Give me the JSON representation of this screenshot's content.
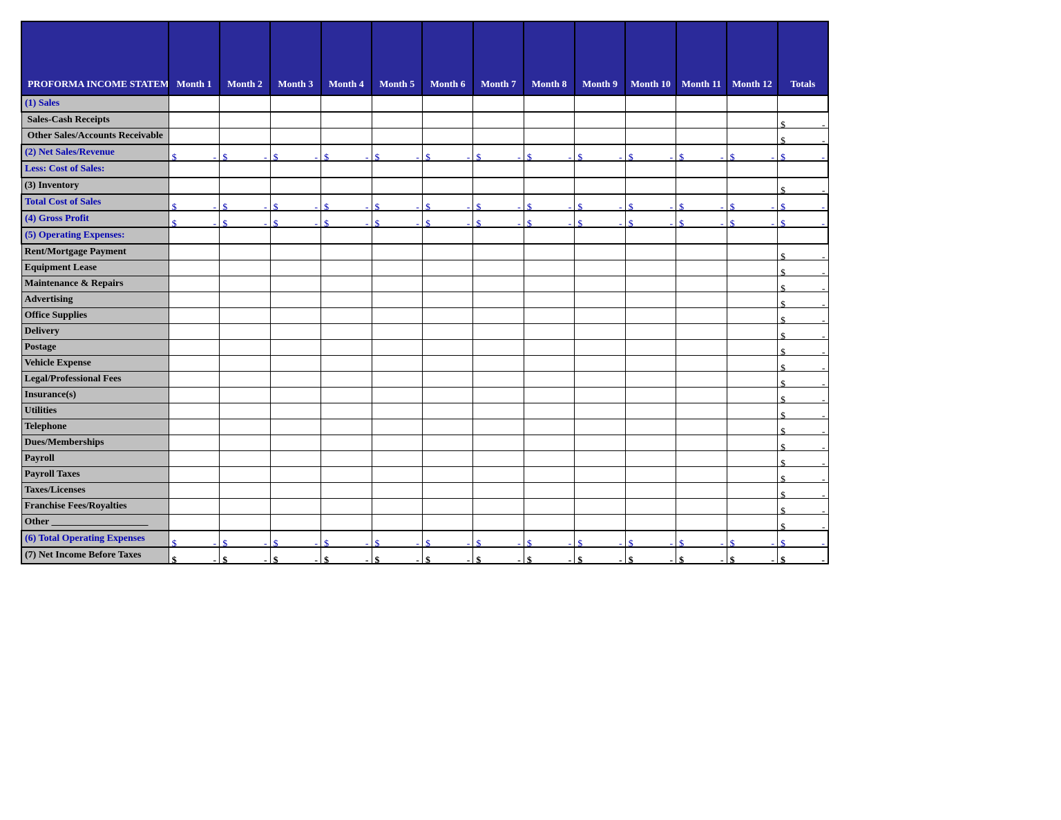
{
  "title": "PROFORMA INCOME STATEMENT",
  "months": [
    "Month 1",
    "Month 2",
    "Month 3",
    "Month 4",
    "Month 5",
    "Month 6",
    "Month 7",
    "Month 8",
    "Month 9",
    "Month 10",
    "Month 11",
    "Month 12"
  ],
  "totals_label": "Totals",
  "currency_symbol": "$",
  "dash": "-",
  "rows": [
    {
      "label": "(1) Sales",
      "style": "section",
      "blue": true,
      "months": "none",
      "total": "none"
    },
    {
      "label": "Sales-Cash Receipts",
      "style": "indent",
      "blue": false,
      "months": "none",
      "total": "dash"
    },
    {
      "label": "Other Sales/Accounts Receivable",
      "style": "indent",
      "blue": false,
      "months": "none",
      "total": "dash"
    },
    {
      "label": "(2) Net Sales/Revenue",
      "style": "subtotal",
      "blue": true,
      "months": "blue",
      "total": "blue"
    },
    {
      "label": "Less: Cost of Sales:",
      "style": "section",
      "blue": true,
      "months": "none",
      "total": "none"
    },
    {
      "label": "(3) Inventory",
      "style": "plain",
      "blue": false,
      "months": "none",
      "total": "dash"
    },
    {
      "label": "Total Cost of Sales",
      "style": "subtotal",
      "blue": true,
      "months": "blue",
      "total": "blue"
    },
    {
      "label": "(4) Gross Profit",
      "style": "subtotal",
      "blue": true,
      "months": "blue",
      "total": "blue"
    },
    {
      "label": "(5) Operating Expenses:",
      "style": "section",
      "blue": true,
      "months": "none",
      "total": "none"
    },
    {
      "label": "Rent/Mortgage Payment",
      "style": "plain",
      "blue": false,
      "months": "none",
      "total": "dash"
    },
    {
      "label": "Equipment Lease",
      "style": "plain",
      "blue": false,
      "months": "none",
      "total": "dash"
    },
    {
      "label": "Maintenance & Repairs",
      "style": "plain",
      "blue": false,
      "months": "none",
      "total": "dash"
    },
    {
      "label": "Advertising",
      "style": "plain",
      "blue": false,
      "months": "none",
      "total": "dash"
    },
    {
      "label": "Office Supplies",
      "style": "plain",
      "blue": false,
      "months": "none",
      "total": "dash"
    },
    {
      "label": "Delivery",
      "style": "plain",
      "blue": false,
      "months": "none",
      "total": "dash"
    },
    {
      "label": "Postage",
      "style": "plain",
      "blue": false,
      "months": "none",
      "total": "dash"
    },
    {
      "label": "Vehicle Expense",
      "style": "plain",
      "blue": false,
      "months": "none",
      "total": "dash"
    },
    {
      "label": "Legal/Professional Fees",
      "style": "plain",
      "blue": false,
      "months": "none",
      "total": "dash"
    },
    {
      "label": "Insurance(s)",
      "style": "plain",
      "blue": false,
      "months": "none",
      "total": "dash"
    },
    {
      "label": "Utilities",
      "style": "plain",
      "blue": false,
      "months": "none",
      "total": "dash"
    },
    {
      "label": "Telephone",
      "style": "plain",
      "blue": false,
      "months": "none",
      "total": "dash"
    },
    {
      "label": "Dues/Memberships",
      "style": "plain",
      "blue": false,
      "months": "none",
      "total": "dash"
    },
    {
      "label": "Payroll",
      "style": "plain",
      "blue": false,
      "months": "none",
      "total": "dash"
    },
    {
      "label": "Payroll Taxes",
      "style": "plain",
      "blue": false,
      "months": "none",
      "total": "dash"
    },
    {
      "label": "Taxes/Licenses",
      "style": "plain",
      "blue": false,
      "months": "none",
      "total": "dash"
    },
    {
      "label": "Franchise Fees/Royalties",
      "style": "plain",
      "blue": false,
      "months": "none",
      "total": "dash"
    },
    {
      "label": "Other ____________________",
      "style": "plain",
      "blue": false,
      "months": "none",
      "total": "dash"
    },
    {
      "label": "(6) Total Operating Expenses",
      "style": "subtotal",
      "blue": true,
      "months": "blue",
      "total": "blue"
    },
    {
      "label": "(7) Net Income Before Taxes",
      "style": "subtotal",
      "blue": false,
      "months": "black",
      "total": "black"
    }
  ]
}
